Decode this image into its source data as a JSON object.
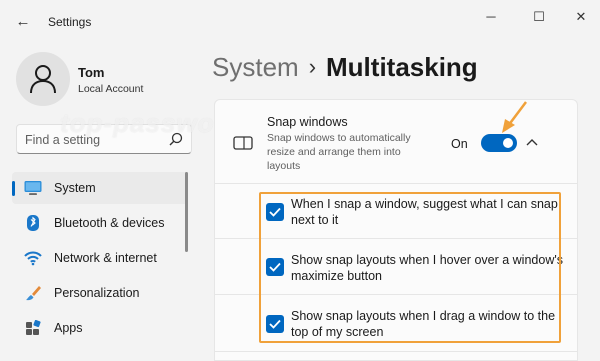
{
  "window": {
    "title": "Settings",
    "back_icon": "arrow-left-icon",
    "controls": {
      "minimize": "─",
      "maximize": "☐",
      "close": "✕"
    }
  },
  "profile": {
    "name": "Tom",
    "account_type": "Local Account"
  },
  "search": {
    "placeholder": "Find a setting",
    "icon": "search-icon"
  },
  "sidebar": {
    "items": [
      {
        "label": "System",
        "icon": "monitor-icon",
        "active": true
      },
      {
        "label": "Bluetooth & devices",
        "icon": "bluetooth-icon",
        "active": false
      },
      {
        "label": "Network & internet",
        "icon": "wifi-icon",
        "active": false
      },
      {
        "label": "Personalization",
        "icon": "brush-icon",
        "active": false
      },
      {
        "label": "Apps",
        "icon": "apps-icon",
        "active": false
      }
    ]
  },
  "breadcrumb": {
    "parent": "System",
    "separator": "›",
    "current": "Multitasking"
  },
  "snap_windows": {
    "title": "Snap windows",
    "description": "Snap windows to automatically resize and arrange them into layouts",
    "toggle_state": "On",
    "enabled": true,
    "expanded": true
  },
  "snap_options": [
    {
      "label": "When I snap a window, suggest what I can snap next to it",
      "checked": true
    },
    {
      "label": "Show snap layouts when I hover over a window's maximize button",
      "checked": true
    },
    {
      "label": "Show snap layouts when I drag a window to the top of my screen",
      "checked": true
    }
  ],
  "watermark": "top-password.com",
  "colors": {
    "accent": "#0067c0",
    "highlight": "#f0a13a",
    "background": "#f3f3f3",
    "card": "#fbfbfb"
  }
}
